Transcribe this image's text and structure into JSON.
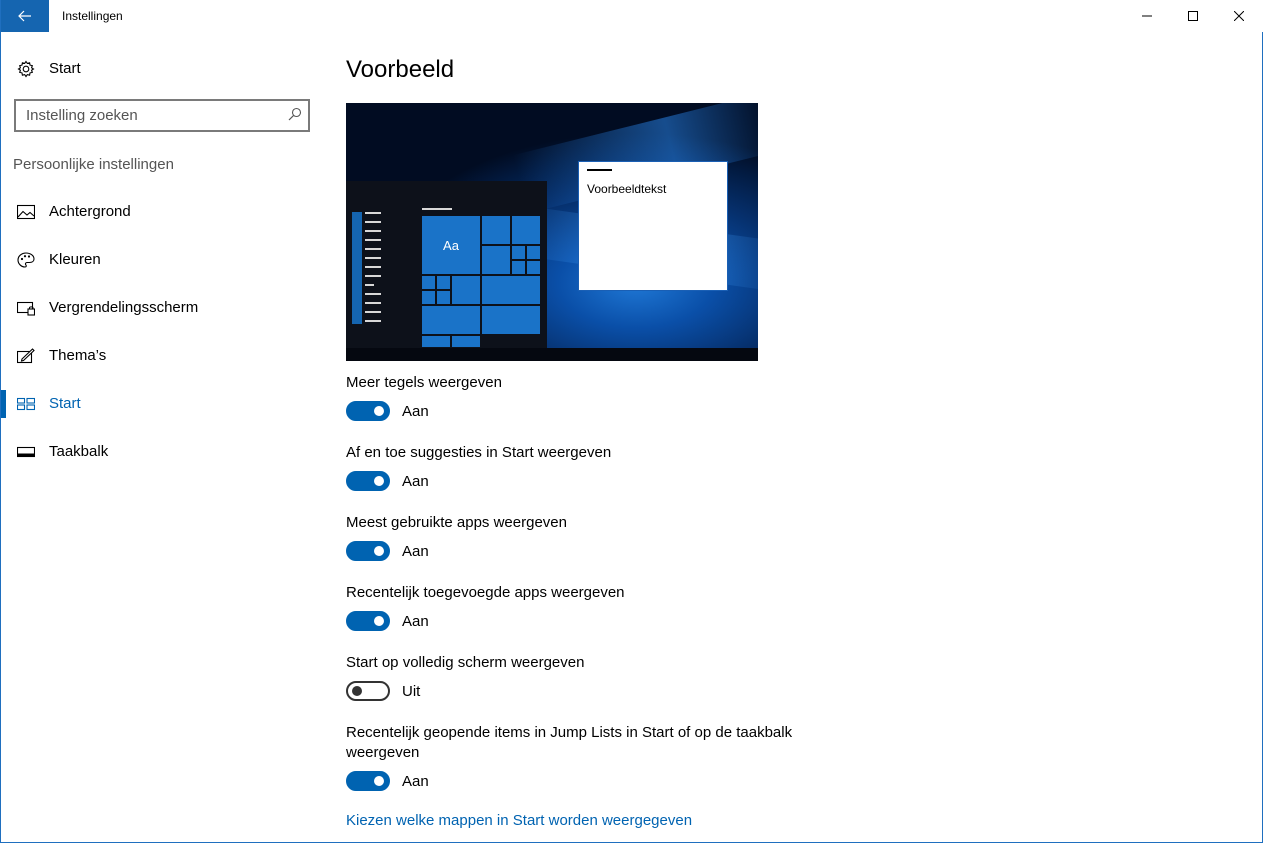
{
  "window": {
    "title": "Instellingen",
    "accent_color": "#0063b1"
  },
  "sidebar": {
    "home_label": "Start",
    "search_placeholder": "Instelling zoeken",
    "section_header": "Persoonlijke instellingen",
    "items": [
      {
        "label": "Achtergrond",
        "icon": "picture-icon",
        "selected": false
      },
      {
        "label": "Kleuren",
        "icon": "palette-icon",
        "selected": false
      },
      {
        "label": "Vergrendelingsscherm",
        "icon": "lockscreen-icon",
        "selected": false
      },
      {
        "label": "Thema’s",
        "icon": "themes-icon",
        "selected": false
      },
      {
        "label": "Start",
        "icon": "start-icon",
        "selected": true
      },
      {
        "label": "Taakbalk",
        "icon": "taskbar-icon",
        "selected": false
      }
    ]
  },
  "main": {
    "title": "Voorbeeld",
    "preview": {
      "tile_text": "Aa",
      "sample_text": "Voorbeeldtekst"
    },
    "settings": [
      {
        "label": "Meer tegels weergeven",
        "state": "Aan",
        "on": true
      },
      {
        "label": "Af en toe suggesties in Start weergeven",
        "state": "Aan",
        "on": true
      },
      {
        "label": "Meest gebruikte apps weergeven",
        "state": "Aan",
        "on": true
      },
      {
        "label": "Recentelijk toegevoegde apps weergeven",
        "state": "Aan",
        "on": true
      },
      {
        "label": "Start op volledig scherm weergeven",
        "state": "Uit",
        "on": false
      },
      {
        "label": "Recentelijk geopende items in Jump Lists in Start of op de taakbalk weergeven",
        "state": "Aan",
        "on": true
      }
    ],
    "link": "Kiezen welke mappen in Start worden weergegeven"
  }
}
